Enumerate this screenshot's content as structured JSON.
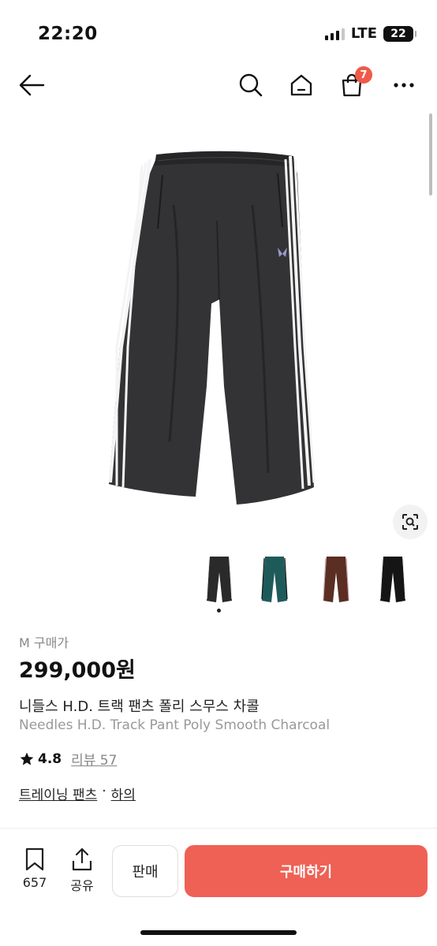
{
  "status_bar": {
    "time": "22:20",
    "network": "LTE",
    "battery": "22"
  },
  "nav": {
    "cart_count": "7"
  },
  "product": {
    "size_label": "M 구매가",
    "price": "299,000원",
    "name_ko": "니들스 H.D. 트랙 팬츠 폴리 스무스 차콜",
    "name_en": "Needles H.D. Track Pant Poly Smooth Charcoal",
    "rating": "4.8",
    "review_label": "리뷰 57",
    "category_primary": "트레이닝 팬츠",
    "category_separator": "·",
    "category_secondary": "하의",
    "thumbnail_colors": [
      "#2a2a2a",
      "#1f5a5a",
      "#5a2e22",
      "#151515"
    ]
  },
  "bottom_bar": {
    "bookmark_count": "657",
    "share_label": "공유",
    "sell_label": "판매",
    "buy_label": "구매하기"
  },
  "colors": {
    "accent": "#ef6154",
    "badge": "#ef5a4a"
  },
  "icons": [
    "back-arrow-icon",
    "search-icon",
    "home-icon",
    "shopping-bag-icon",
    "more-icon",
    "lens-search-icon",
    "bookmark-icon",
    "share-icon",
    "star-icon"
  ]
}
